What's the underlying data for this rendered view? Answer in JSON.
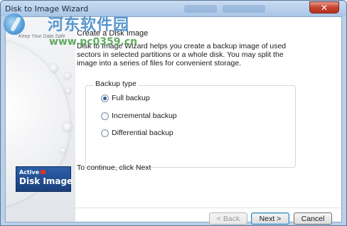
{
  "window": {
    "title": "Disk to Image Wizard",
    "close_glyph": "✕",
    "close_color": "#c54330"
  },
  "sidebar": {
    "tagline": "Keep Your Data Safe",
    "logo_top": "Active",
    "logo_name": "Disk Image",
    "logo_color": "#1f4a8e"
  },
  "watermark": {
    "title": "河东软件园",
    "url": "www.pc0359.cn"
  },
  "content": {
    "heading": "Create a Disk Image",
    "description": "Disk to Image Wizard helps you create a backup image of used sectors in selected partitions or a whole disk. You may split the image into a series of files for convenient storage.",
    "group_label": "Backup type",
    "options": [
      {
        "label": "Full backup",
        "selected": true
      },
      {
        "label": "Incremental backup",
        "selected": false
      },
      {
        "label": "Differential backup",
        "selected": false
      }
    ],
    "continue_text": "To continue, click Next"
  },
  "buttons": {
    "back": "< Back",
    "next": "Next >",
    "cancel": "Cancel"
  }
}
